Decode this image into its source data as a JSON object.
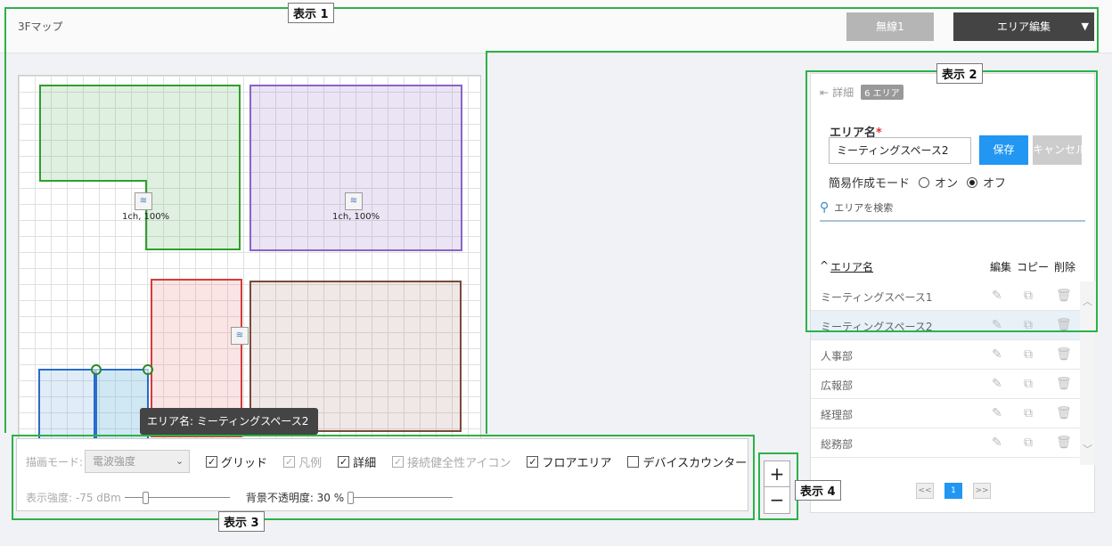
{
  "header": {
    "title": "3Fマップ",
    "wireless_button": "無線1",
    "area_edit_button": "エリア編集",
    "area_edit_caret": "▼"
  },
  "map": {
    "areas": [
      {
        "name": "meeting-space-1",
        "color": "#2da02d"
      },
      {
        "name": "purple-area",
        "color": "#8a63c8"
      },
      {
        "name": "red-area",
        "color": "#d83a3a"
      },
      {
        "name": "brown-area",
        "color": "#7a4a3a"
      },
      {
        "name": "blue-area-1",
        "color": "#2a6cc9"
      },
      {
        "name": "blue-area-2",
        "color": "#2a6cc9"
      }
    ],
    "access_points": [
      {
        "label": "1ch, 100%"
      },
      {
        "label": "1ch, 100%"
      },
      {
        "label": ""
      }
    ],
    "tooltip": "エリア名: ミーティングスペース2"
  },
  "controls": {
    "draw_mode_label": "描画モード:",
    "draw_mode_value": "電波強度",
    "checkboxes": [
      {
        "label": "グリッド",
        "checked": true,
        "enabled": true
      },
      {
        "label": "凡例",
        "checked": true,
        "enabled": false
      },
      {
        "label": "詳細",
        "checked": true,
        "enabled": true
      },
      {
        "label": "接続健全性アイコン",
        "checked": true,
        "enabled": false
      },
      {
        "label": "フロアエリア",
        "checked": true,
        "enabled": true
      },
      {
        "label": "デバイスカウンター",
        "checked": false,
        "enabled": true
      }
    ],
    "strength_label": "表示強度: -75 dBm",
    "opacity_label": "背景不透明度: 30 %"
  },
  "zoom": {
    "in": "+",
    "out": "−"
  },
  "panel": {
    "detail_label": "詳細",
    "count_badge": "6 エリア",
    "name_label": "エリア名",
    "required_mark": "*",
    "name_value": "ミーティングスペース2",
    "save_button": "保存",
    "cancel_button": "キャンセル",
    "mode_label": "簡易作成モード",
    "mode_on": "オン",
    "mode_off": "オフ",
    "mode_selected": "off",
    "search_placeholder": "エリアを検索",
    "columns": {
      "name": "エリア名",
      "sort": "^",
      "edit": "編集",
      "copy": "コピー",
      "delete": "削除"
    },
    "rows": [
      {
        "name": "ミーティングスペース1",
        "selected": false
      },
      {
        "name": "ミーティングスペース2",
        "selected": true
      },
      {
        "name": "人事部",
        "selected": false
      },
      {
        "name": "広報部",
        "selected": false
      },
      {
        "name": "経理部",
        "selected": false
      },
      {
        "name": "総務部",
        "selected": false
      }
    ],
    "pager": {
      "prev": "<<",
      "current": "1",
      "next": ">>"
    }
  },
  "annotations": [
    {
      "label": "表示 1"
    },
    {
      "label": "表示 2"
    },
    {
      "label": "表示 3"
    },
    {
      "label": "表示 4"
    }
  ],
  "colors": {
    "accent": "#2196f3",
    "annotation": "#2db14a"
  }
}
